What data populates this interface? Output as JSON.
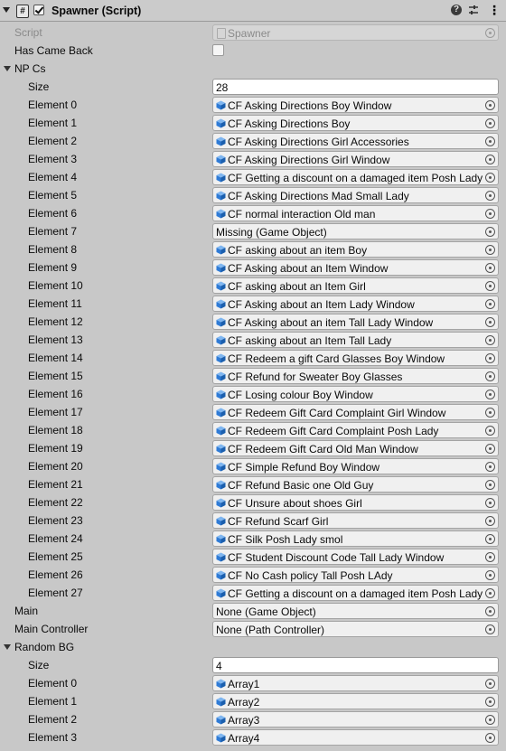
{
  "header": {
    "title": "Spawner (Script)",
    "script_glyph": "#"
  },
  "script_row": {
    "label": "Script",
    "value": "Spawner"
  },
  "has_came_back": {
    "label": "Has Came Back",
    "checked": false
  },
  "npcs": {
    "label": "NP Cs",
    "size_label": "Size",
    "size_value": "28",
    "elements": [
      {
        "label": "Element 0",
        "value": "CF Asking Directions Boy Window"
      },
      {
        "label": "Element 1",
        "value": "CF Asking Directions Boy"
      },
      {
        "label": "Element 2",
        "value": "CF Asking Directions Girl Accessories"
      },
      {
        "label": "Element 3",
        "value": "CF Asking Directions Girl Window"
      },
      {
        "label": "Element 4",
        "value": "CF Getting a discount on a damaged item Posh Lady"
      },
      {
        "label": "Element 5",
        "value": "CF Asking Directions Mad Small Lady"
      },
      {
        "label": "Element 6",
        "value": "CF normal interaction Old man"
      },
      {
        "label": "Element 7",
        "value": "Missing (Game Object)"
      },
      {
        "label": "Element 8",
        "value": "CF asking about an item Boy"
      },
      {
        "label": "Element 9",
        "value": "CF Asking about an Item Window"
      },
      {
        "label": "Element 10",
        "value": "CF asking about an Item Girl"
      },
      {
        "label": "Element 11",
        "value": "CF Asking about an Item Lady Window"
      },
      {
        "label": "Element 12",
        "value": "CF Asking about an item Tall Lady Window"
      },
      {
        "label": "Element 13",
        "value": "CF asking about an Item Tall Lady"
      },
      {
        "label": "Element 14",
        "value": "CF Redeem a gift Card Glasses Boy Window"
      },
      {
        "label": "Element 15",
        "value": "CF Refund for Sweater Boy Glasses"
      },
      {
        "label": "Element 16",
        "value": "CF Losing colour Boy Window"
      },
      {
        "label": "Element 17",
        "value": "CF Redeem Gift Card Complaint Girl Window"
      },
      {
        "label": "Element 18",
        "value": "CF Redeem Gift Card Complaint Posh Lady"
      },
      {
        "label": "Element 19",
        "value": "CF Redeem Gift Card Old Man Window"
      },
      {
        "label": "Element 20",
        "value": "CF Simple Refund Boy Window"
      },
      {
        "label": "Element 21",
        "value": "CF Refund Basic one Old Guy"
      },
      {
        "label": "Element 22",
        "value": "CF Unsure about shoes Girl"
      },
      {
        "label": "Element 23",
        "value": "CF Refund Scarf Girl"
      },
      {
        "label": "Element 24",
        "value": "CF Silk Posh Lady smol"
      },
      {
        "label": "Element 25",
        "value": "CF Student Discount Code Tall Lady Window"
      },
      {
        "label": "Element 26",
        "value": "CF No Cash policy Tall Posh LAdy"
      },
      {
        "label": "Element 27",
        "value": "CF Getting a discount on a damaged item Posh Lady"
      }
    ]
  },
  "main": {
    "label": "Main",
    "value": "None (Game Object)"
  },
  "main_controller": {
    "label": "Main Controller",
    "value": "None (Path Controller)"
  },
  "random_bg": {
    "label": "Random BG",
    "size_label": "Size",
    "size_value": "4",
    "elements": [
      {
        "label": "Element 0",
        "value": "Array1"
      },
      {
        "label": "Element 1",
        "value": "Array2"
      },
      {
        "label": "Element 2",
        "value": "Array3"
      },
      {
        "label": "Element 3",
        "value": "Array4"
      }
    ]
  },
  "colors": {
    "background": "#c8c8c8",
    "cube_icon": "#2f7bd6",
    "field_bg": "#f0f0f0"
  }
}
